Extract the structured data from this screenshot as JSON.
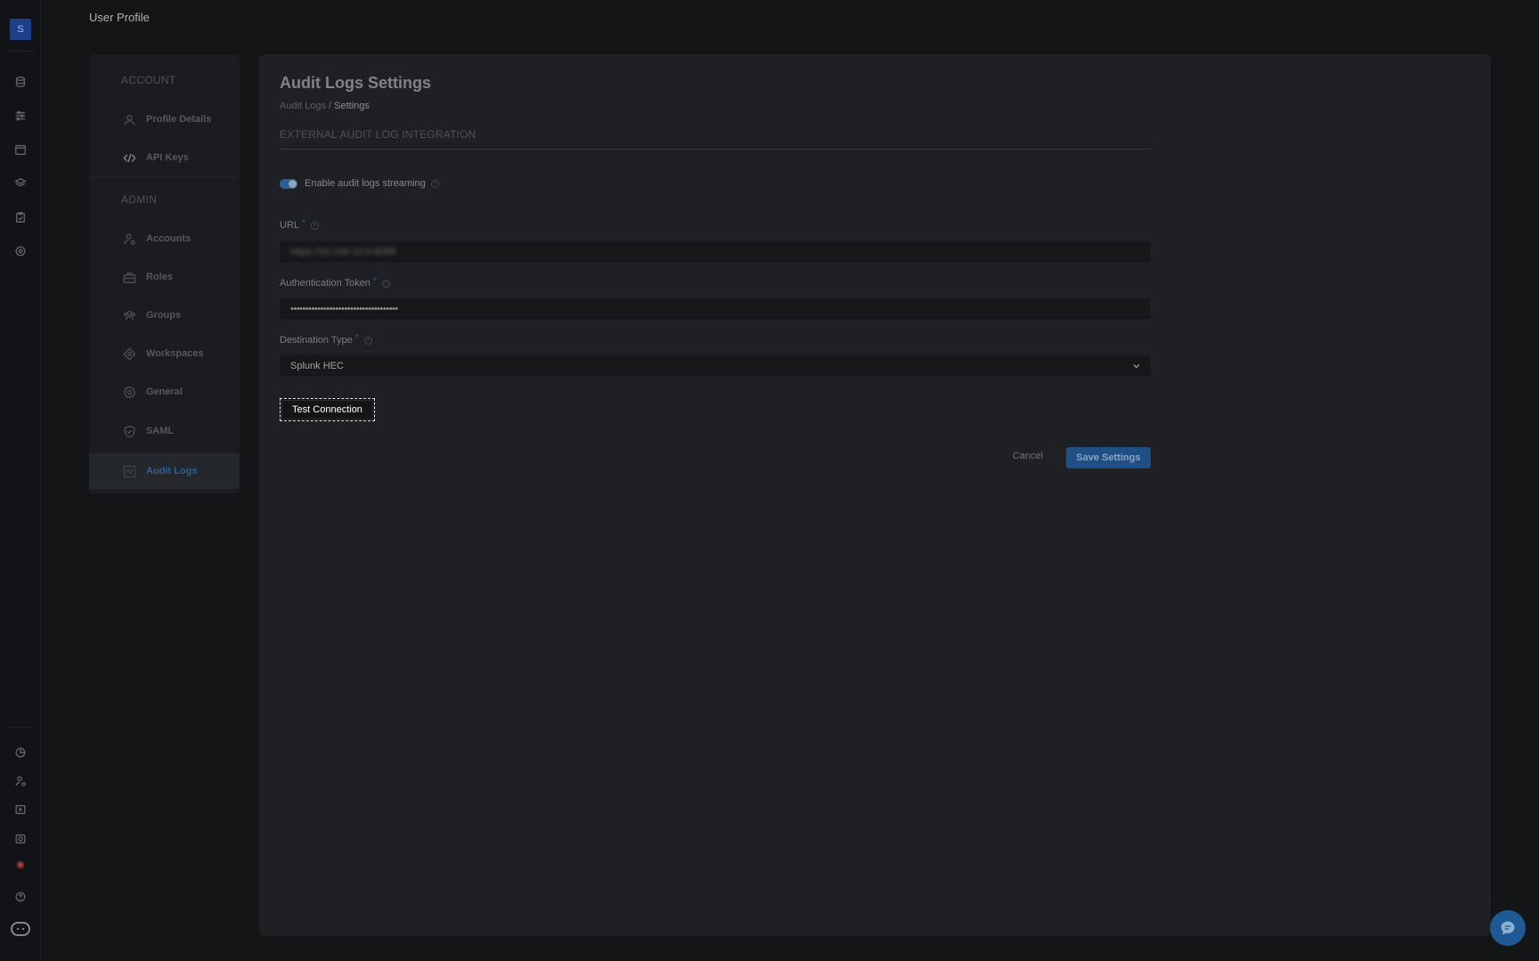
{
  "rail": {
    "avatar_letter": "S",
    "top_icons": [
      "database-icon",
      "sliders-icon",
      "calendar-icon",
      "layers-icon",
      "clipboard-check-icon",
      "target-icon"
    ],
    "bottom_icons": [
      "pie-chart-icon",
      "user-settings-icon",
      "media-icon",
      "camera-icon",
      "alert-dot-icon",
      "help-icon",
      "bot-icon"
    ]
  },
  "header": {
    "title": "User Profile"
  },
  "nav": {
    "sections": [
      {
        "title": "ACCOUNT",
        "items": [
          {
            "label": "Profile Details",
            "icon": "user-icon"
          },
          {
            "label": "API Keys",
            "icon": "code-icon"
          }
        ]
      },
      {
        "title": "ADMIN",
        "items": [
          {
            "label": "Accounts",
            "icon": "user-cog-icon"
          },
          {
            "label": "Roles",
            "icon": "briefcase-icon"
          },
          {
            "label": "Groups",
            "icon": "users-icon"
          },
          {
            "label": "Workspaces",
            "icon": "diamond-icon"
          },
          {
            "label": "General",
            "icon": "settings-circle-icon"
          },
          {
            "label": "SAML",
            "icon": "shield-icon"
          },
          {
            "label": "Audit Logs",
            "icon": "activity-icon",
            "active": true
          }
        ]
      }
    ]
  },
  "main": {
    "title": "Audit Logs Settings",
    "breadcrumb": {
      "parent": "Audit Logs",
      "separator": "/",
      "current": "Settings"
    },
    "section_title": "EXTERNAL AUDIT LOG INTEGRATION",
    "toggle": {
      "label": "Enable audit logs streaming",
      "enabled": true
    },
    "url": {
      "label": "URL",
      "required": "*",
      "value": "https://10.100.10.5:8088"
    },
    "token": {
      "label": "Authentication Token",
      "required": "*",
      "value": "••••••••••••••••••••••••••••••••••••"
    },
    "destination": {
      "label": "Destination Type",
      "required": "*",
      "value": "Splunk HEC"
    },
    "test_button": "Test Connection",
    "cancel_button": "Cancel",
    "save_button": "Save Settings"
  },
  "colors": {
    "accent": "#2c5f98",
    "background": "#141517",
    "panel": "#1f2023"
  }
}
